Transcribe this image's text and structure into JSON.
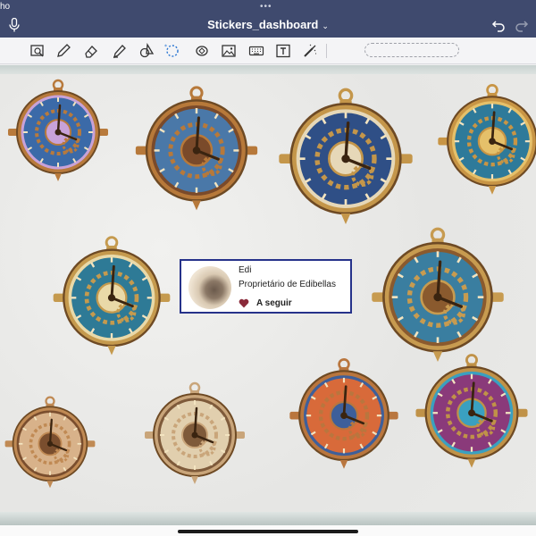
{
  "status": {
    "left_text": "ho",
    "dots": "•••"
  },
  "header": {
    "title": "Stickers_dashboard",
    "title_caret": "⌄"
  },
  "toolbar": {
    "tools": [
      "image-search-tool",
      "pen-tool",
      "eraser-tool",
      "highlighter-tool",
      "shapes-tool",
      "lasso-tool",
      "sticker-tool",
      "image-tool",
      "keyboard-tool",
      "text-tool",
      "magic-tool"
    ]
  },
  "profile": {
    "name": "Edi",
    "description": "Proprietário de Edibellas",
    "follow_label": "A seguir",
    "heart_color": "#8a2a3a"
  },
  "colors": {
    "nav": "#3f4a6e",
    "accent": "#26328a"
  },
  "stickers": [
    {
      "name": "sticker-steampunk-clock-1",
      "palette": [
        "#b87a3c",
        "#3b6aa8",
        "#c8a2d8"
      ]
    },
    {
      "name": "sticker-steampunk-clock-2",
      "palette": [
        "#b7793a",
        "#4a78a8",
        "#7a4a2a"
      ]
    },
    {
      "name": "sticker-steampunk-clock-3",
      "palette": [
        "#c4964a",
        "#2f4f86",
        "#e6d8b8"
      ]
    },
    {
      "name": "sticker-steampunk-clock-4",
      "palette": [
        "#c89545",
        "#2e7a9a",
        "#e5c06a"
      ]
    },
    {
      "name": "sticker-steampunk-clock-5",
      "palette": [
        "#c59a4e",
        "#2e7a96",
        "#e9d9a8"
      ]
    },
    {
      "name": "sticker-steampunk-clock-6",
      "palette": [
        "#c79b50",
        "#3a7ea0",
        "#8a5a2e"
      ]
    },
    {
      "name": "sticker-steampunk-clock-7",
      "palette": [
        "#c08a54",
        "#d8b28a",
        "#7a4e2e"
      ]
    },
    {
      "name": "sticker-steampunk-clock-8",
      "palette": [
        "#c9a57a",
        "#e1cfae",
        "#7e5a3a"
      ]
    },
    {
      "name": "sticker-steampunk-clock-9",
      "palette": [
        "#b9763e",
        "#d86a3a",
        "#3e5f9a"
      ]
    },
    {
      "name": "sticker-steampunk-clock-10",
      "palette": [
        "#c09248",
        "#8a3a7a",
        "#3aa0c0"
      ]
    }
  ]
}
